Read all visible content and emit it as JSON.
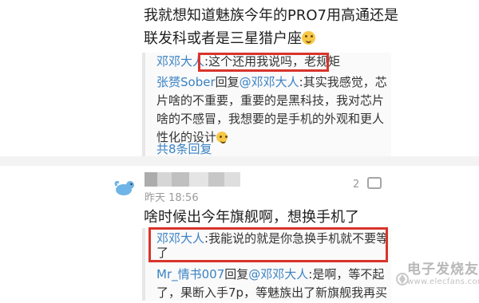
{
  "first_comment": {
    "text_line1": "我就想知道魅族今年的PRO7用高通还是",
    "text_line2": "联发科或者是三星猎户座",
    "reply_block": {
      "reply1_user": "邓邓大人",
      "reply1_sep": ":",
      "reply1_text": "这个还用我说吗，老规矩",
      "reply2_user": "张赟Sober",
      "reply2_mid": "回复",
      "reply2_target": "@邓邓大人",
      "reply2_text_line1": ":其实我感觉，芯",
      "reply2_text_line2": "片啥的不重要，重要的是黑科技，我对芯片",
      "reply2_text_line3": "啥的不感冒，我想要的是手机的外观和更人",
      "reply2_text_line4": "性化的设计",
      "more_replies": "共8条回复"
    }
  },
  "second_comment": {
    "time": "昨天 18:56",
    "likes": "2",
    "text": "啥时候出今年旗舰啊，想换手机了",
    "reply_block": {
      "reply1_user": "邓邓大人",
      "reply1_text_line1": ":我能说的就是你急换手机就不要等",
      "reply1_text_line2": "了",
      "reply2_user": "Mr_情书007",
      "reply2_mid": "回复",
      "reply2_target": "@邓邓大人",
      "reply2_text_line1": ":是啊，等不起",
      "reply2_text_line2": "了，果断入手7p，等魅族出了新旗舰我再买"
    }
  },
  "watermark": {
    "title": "电子发烧友",
    "url": "www.elecfans.com"
  },
  "colors": {
    "link": "#3a82c4",
    "highlight_box": "#d9342b",
    "time_gray": "#9a9a9a"
  },
  "icons": {
    "emoji": "smile-emoji-icon",
    "avatar": "bird-avatar-icon",
    "reply": "comment-icon"
  }
}
